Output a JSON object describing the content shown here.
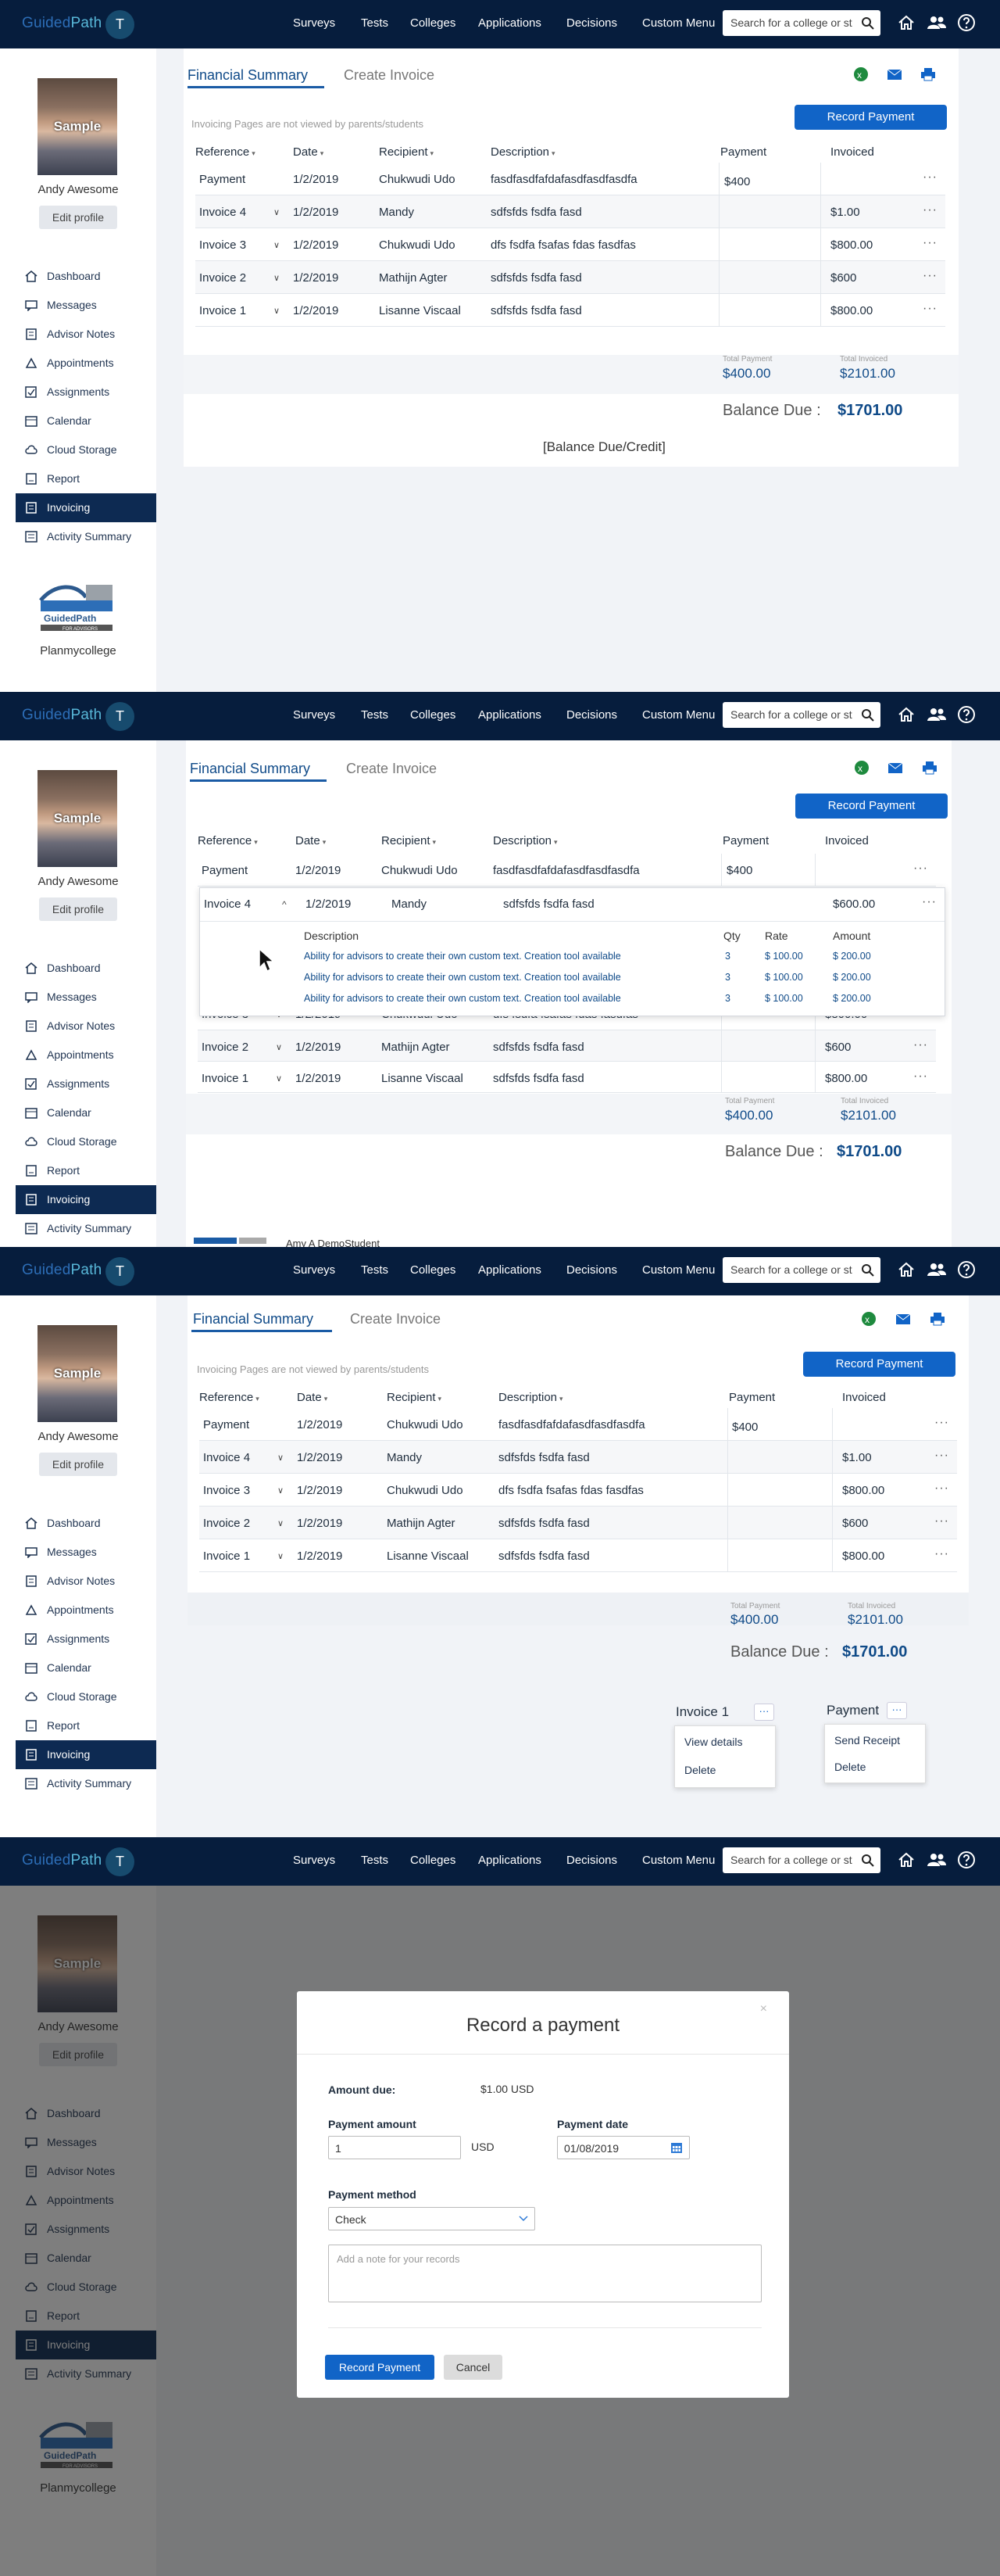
{
  "topbar": {
    "logo_a": "Guided",
    "logo_b": "Path",
    "user_initial": "T",
    "nav": [
      "Surveys",
      "Tests",
      "Colleges",
      "Applications",
      "Decisions",
      "Custom Menu"
    ],
    "search_placeholder": "Search for a college or st"
  },
  "sidebar": {
    "photo_label": "Sample",
    "user_name": "Andy Awesome",
    "edit_profile": "Edit profile",
    "items": [
      "Dashboard",
      "Messages",
      "Advisor Notes",
      "Appointments",
      "Assignments",
      "Calendar",
      "Cloud Storage",
      "Report",
      "Invoicing",
      "Activity Summary"
    ],
    "active_item": "Invoicing",
    "logo_text": "GuidedPath",
    "logo_sub": "FOR ADVISORS",
    "college": "Planmycollege"
  },
  "tabs": {
    "financial_summary": "Financial Summary",
    "create_invoice": "Create Invoice"
  },
  "note": "Invoicing Pages are not viewed by parents/students",
  "record_payment_button": "Record Payment",
  "table": {
    "headers": [
      "Reference",
      "Date",
      "Recipient",
      "Description",
      "Payment",
      "Invoiced"
    ],
    "rows": [
      {
        "ref": "Payment",
        "date": "1/2/2019",
        "recipient": "Chukwudi Udo",
        "desc": "fasdfasdfafdafasdfasdfasdfa",
        "payment": "$400",
        "invoiced": ""
      },
      {
        "ref": "Invoice 4",
        "date": "1/2/2019",
        "recipient": "Mandy",
        "desc": "sdfsfds fsdfa fasd",
        "payment": "",
        "invoiced": "$1.00"
      },
      {
        "ref": "Invoice 3",
        "date": "1/2/2019",
        "recipient": "Chukwudi Udo",
        "desc": "dfs fsdfa fsafas fdas fasdfas",
        "payment": "",
        "invoiced": "$800.00"
      },
      {
        "ref": "Invoice 2",
        "date": "1/2/2019",
        "recipient": "Mathijn Agter",
        "desc": "sdfsfds fsdfa fasd",
        "payment": "",
        "invoiced": "$600"
      },
      {
        "ref": "Invoice 1",
        "date": "1/2/2019",
        "recipient": "Lisanne Viscaal",
        "desc": "sdfsfds fsdfa fasd",
        "payment": "",
        "invoiced": "$800.00"
      }
    ],
    "expanded_invoiced": "$600.00",
    "more": "···",
    "chev_down": "∨",
    "chev_up": "^"
  },
  "totals": {
    "payment_label": "Total Payment",
    "payment_value": "$400.00",
    "invoiced_label": "Total Invoiced",
    "invoiced_value": "$2101.00",
    "balance_label": "Balance Due :",
    "balance_value": "$1701.00"
  },
  "balance_placeholder": "[Balance Due/Credit]",
  "expanded": {
    "headers": [
      "Description",
      "Qty",
      "Rate",
      "Amount"
    ],
    "lines": [
      {
        "desc": "Ability for advisors to create their own custom text. Creation tool available",
        "qty": "3",
        "rate": "$ 100.00",
        "amount": "$ 200.00"
      },
      {
        "desc": "Ability for advisors to create their own custom text. Creation tool available",
        "qty": "3",
        "rate": "$ 100.00",
        "amount": "$ 200.00"
      },
      {
        "desc": "Ability for advisors to create their own custom text. Creation tool available",
        "qty": "3",
        "rate": "$ 100.00",
        "amount": "$ 200.00"
      }
    ]
  },
  "student_strip": "Amy A DemoStudent",
  "menus": {
    "invoice_title": "Invoice 1",
    "invoice_items": [
      "View details",
      "Delete"
    ],
    "payment_title": "Payment",
    "payment_items": [
      "Send Receipt",
      "Delete"
    ],
    "dots": "···"
  },
  "modal": {
    "title": "Record a payment",
    "close": "×",
    "amount_due_label": "Amount due:",
    "amount_due_value": "$1.00 USD",
    "payment_amount_label": "Payment amount",
    "payment_amount_value": "1",
    "currency": "USD",
    "payment_date_label": "Payment date",
    "payment_date_value": "01/08/2019",
    "payment_method_label": "Payment method",
    "payment_method_value": "Check",
    "note_placeholder": "Add a note for your records",
    "record_button": "Record Payment",
    "cancel_button": "Cancel"
  },
  "colors": {
    "navy": "#061d3d",
    "brand_blue": "#1164c7",
    "accent_blue": "#0f4a88",
    "active_menu": "#0d2a52"
  }
}
